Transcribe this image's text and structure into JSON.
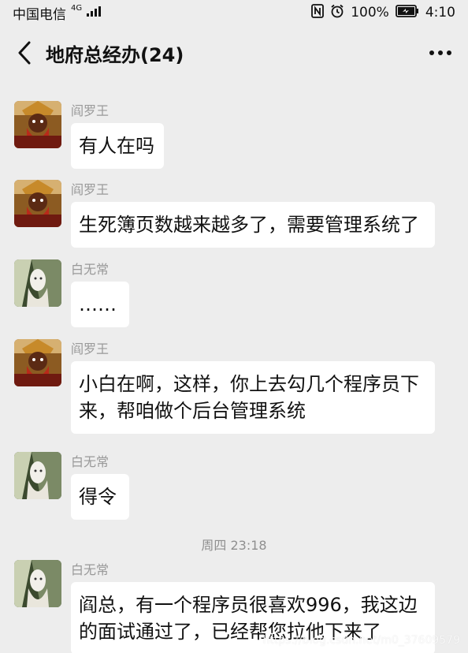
{
  "status": {
    "carrier": "中国电信",
    "network": "4G",
    "battery_percent": "100%",
    "time": "4:10"
  },
  "nav": {
    "title": "地府总经办(24)"
  },
  "messages": [
    {
      "sender": "阎罗王",
      "text": "有人在吗",
      "avatar": "yama-avatar"
    },
    {
      "sender": "阎罗王",
      "text": "生死簿页数越来越多了，需要管理系统了",
      "avatar": "yama-avatar"
    },
    {
      "sender": "白无常",
      "text": "……",
      "avatar": "bai-wuchang-avatar"
    },
    {
      "sender": "阎罗王",
      "text": "小白在啊，这样，你上去勾几个程序员下来，帮咱做个后台管理系统",
      "avatar": "yama-avatar"
    },
    {
      "sender": "白无常",
      "text": "得令",
      "avatar": "bai-wuchang-avatar"
    }
  ],
  "timestamp": "周四 23:18",
  "messages_after": [
    {
      "sender": "白无常",
      "text": "阎总，有一个程序员很喜欢996，我这边的面试通过了，已经帮您拉他下来了",
      "avatar": "bai-wuchang-avatar"
    }
  ],
  "watermark": "https://blog.csdn.net/m0_37609579",
  "colors": {
    "background": "#ededed",
    "bubble": "#ffffff",
    "sender": "#999999",
    "timestamp": "#8f8f8f"
  }
}
